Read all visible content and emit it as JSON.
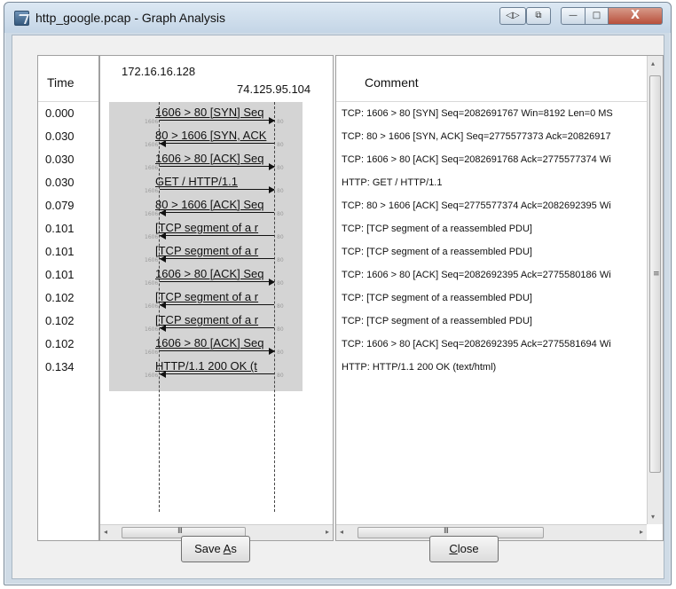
{
  "window": {
    "title": "http_google.pcap - Graph Analysis"
  },
  "titlebar_buttons": {
    "minimize": "—",
    "maximize": "□",
    "close": "X"
  },
  "columns": {
    "time_header": "Time",
    "comment_header": "Comment"
  },
  "hosts": {
    "left": "172.16.16.128",
    "right": "74.125.95.104"
  },
  "rows": [
    {
      "time": "0.000",
      "label": "1606 > 80 [SYN] Seq",
      "dir": "right",
      "left_port": "1606",
      "right_port": "80",
      "comment": "TCP: 1606 > 80 [SYN] Seq=2082691767 Win=8192 Len=0 MS"
    },
    {
      "time": "0.030",
      "label": "80 > 1606 [SYN, ACK",
      "dir": "left",
      "left_port": "1606",
      "right_port": "80",
      "comment": "TCP: 80 > 1606 [SYN, ACK] Seq=2775577373 Ack=20826917"
    },
    {
      "time": "0.030",
      "label": "1606 > 80 [ACK] Seq",
      "dir": "right",
      "left_port": "1606",
      "right_port": "80",
      "comment": "TCP: 1606 > 80 [ACK] Seq=2082691768 Ack=2775577374 Wi"
    },
    {
      "time": "0.030",
      "label": "GET / HTTP/1.1",
      "dir": "right",
      "left_port": "1606",
      "right_port": "80",
      "comment": "HTTP: GET / HTTP/1.1"
    },
    {
      "time": "0.079",
      "label": "80 > 1606 [ACK] Seq",
      "dir": "left",
      "left_port": "1606",
      "right_port": "80",
      "comment": "TCP: 80 > 1606 [ACK] Seq=2775577374 Ack=2082692395 Wi"
    },
    {
      "time": "0.101",
      "label": "[TCP segment of a r",
      "dir": "left",
      "left_port": "1606",
      "right_port": "80",
      "comment": "TCP: [TCP segment of a reassembled PDU]"
    },
    {
      "time": "0.101",
      "label": "[TCP segment of a r",
      "dir": "left",
      "left_port": "1606",
      "right_port": "80",
      "comment": "TCP: [TCP segment of a reassembled PDU]"
    },
    {
      "time": "0.101",
      "label": "1606 > 80 [ACK] Seq",
      "dir": "right",
      "left_port": "1606",
      "right_port": "80",
      "comment": "TCP: 1606 > 80 [ACK] Seq=2082692395 Ack=2775580186 Wi"
    },
    {
      "time": "0.102",
      "label": "[TCP segment of a r",
      "dir": "left",
      "left_port": "1606",
      "right_port": "80",
      "comment": "TCP: [TCP segment of a reassembled PDU]"
    },
    {
      "time": "0.102",
      "label": "[TCP segment of a r",
      "dir": "left",
      "left_port": "1606",
      "right_port": "80",
      "comment": "TCP: [TCP segment of a reassembled PDU]"
    },
    {
      "time": "0.102",
      "label": "1606 > 80 [ACK] Seq",
      "dir": "right",
      "left_port": "1606",
      "right_port": "80",
      "comment": "TCP: 1606 > 80 [ACK] Seq=2082692395 Ack=2775581694 Wi"
    },
    {
      "time": "0.134",
      "label": "HTTP/1.1 200 OK (t",
      "dir": "left",
      "left_port": "1606",
      "right_port": "80",
      "comment": "HTTP: HTTP/1.1 200 OK  (text/html)"
    }
  ],
  "scroll": {
    "grip": "III",
    "vgrip": "≡",
    "left_arrow": "◂",
    "right_arrow": "▸",
    "up_arrow": "▴",
    "down_arrow": "▾"
  },
  "buttons": {
    "save_as": "Save As",
    "close": "Close"
  }
}
